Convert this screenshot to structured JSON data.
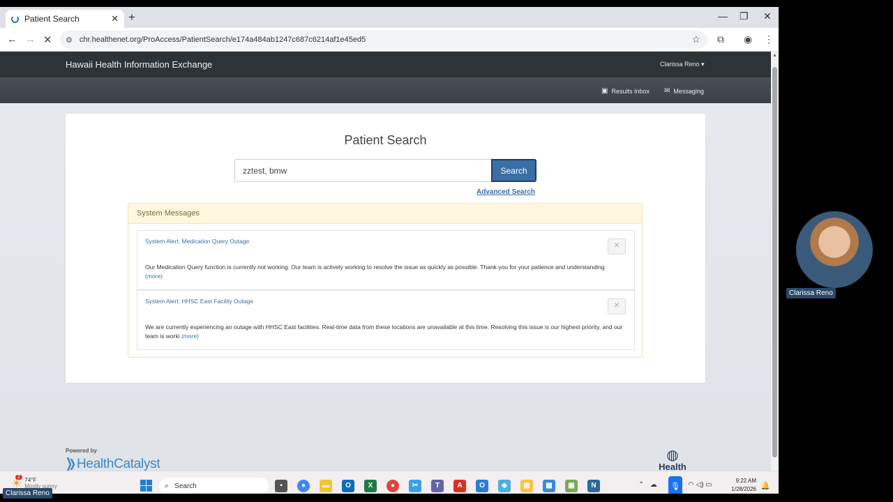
{
  "browser": {
    "tab_title": "Patient Search",
    "url": "chr.healthenet.org/ProAccess/PatientSearch/e174a484ab1247c687c6214af1e45ed5"
  },
  "header": {
    "brand": "Hawaii Health Information Exchange",
    "user_menu": "Clarissa Reno",
    "results_inbox": "Results Inbox",
    "messaging": "Messaging"
  },
  "search": {
    "title": "Patient Search",
    "query": "zztest, bmw",
    "button": "Search",
    "advanced": "Advanced Search"
  },
  "system_messages": {
    "heading": "System Messages",
    "alerts": [
      {
        "title": "System Alert: Medication Query Outage",
        "body": "Our Medication Query function is currently not working. Our team is actively working to resolve the issue as quickly as possible. Thank you for your patience and understanding.",
        "more": "(more)"
      },
      {
        "title": "System Alert: HHSC East Facility Outage",
        "body": "We are currently experiencing an outage with HHSC East facilities. Real-time data from these locations are unavailable at this time. Resolving this issue is our highest priority, and our team is worki",
        "more": "(more)"
      }
    ]
  },
  "footer": {
    "powered_by": "Powered by",
    "health_catalyst": "HealthCatalyst",
    "healthnet": "Health"
  },
  "taskbar": {
    "weather_badge": "2",
    "temperature": "74°F",
    "condition": "Mostly sunny",
    "search_placeholder": "Search",
    "time": "9:22 AM",
    "date": "1/28/2026"
  },
  "participants": {
    "video_name": "Clarissa Reno",
    "self_name": "Clarissa Reno"
  },
  "colors": {
    "nav_dark": "#2e3338",
    "accent_blue": "#3a6ea5",
    "message_header": "#fcf7dd"
  }
}
